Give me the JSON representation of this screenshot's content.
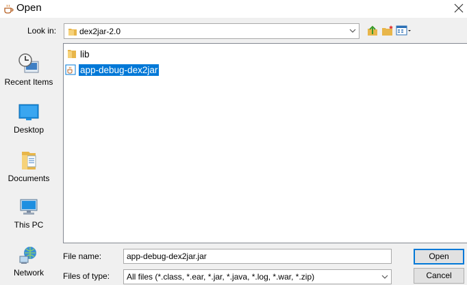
{
  "window": {
    "title": "Open",
    "icon": "java-coffee-icon",
    "close_icon": "close-icon"
  },
  "look_in": {
    "label": "Look in:",
    "value": "dex2jar-2.0",
    "icon": "folder-icon"
  },
  "toolbar": {
    "up_icon": "up-one-level-icon",
    "new_folder_icon": "new-folder-icon",
    "view_icon": "view-menu-icon"
  },
  "places": [
    {
      "label": "Recent Items",
      "icon": "recent-items-icon"
    },
    {
      "label": "Desktop",
      "icon": "desktop-icon"
    },
    {
      "label": "Documents",
      "icon": "documents-icon"
    },
    {
      "label": "This PC",
      "icon": "this-pc-icon"
    },
    {
      "label": "Network",
      "icon": "network-icon"
    }
  ],
  "files": [
    {
      "name": "lib",
      "icon": "folder-icon",
      "selected": false
    },
    {
      "name": "app-debug-dex2jar",
      "icon": "jar-file-icon",
      "selected": true
    }
  ],
  "file_name": {
    "label": "File name:",
    "value": "app-debug-dex2jar.jar"
  },
  "file_type": {
    "label": "Files of type:",
    "value": "All files (*.class, *.ear, *.jar, *.java, *.log, *.war, *.zip)"
  },
  "buttons": {
    "open": "Open",
    "cancel": "Cancel"
  },
  "colors": {
    "selection": "#0078d7",
    "folder": "#e8b64a",
    "dialog_bg": "#f0f0f0"
  }
}
